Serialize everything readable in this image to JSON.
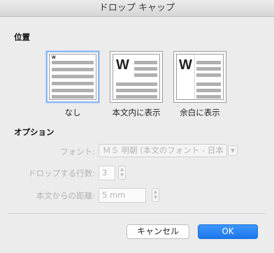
{
  "window": {
    "title": "ドロップ キャップ"
  },
  "position_section": {
    "title": "位置",
    "options": [
      {
        "label": "なし",
        "selected": true,
        "preview_letter": "W"
      },
      {
        "label": "本文内に表示",
        "selected": false,
        "preview_letter": "W"
      },
      {
        "label": "余白に表示",
        "selected": false,
        "preview_letter": "W"
      }
    ]
  },
  "options_section": {
    "title": "オプション",
    "font": {
      "label": "フォント:",
      "value": "ＭＳ 明朝 (本文のフォント - 日本"
    },
    "lines": {
      "label": "ドロップする行数:",
      "value": "3"
    },
    "distance": {
      "label": "本文からの距離:",
      "value": "5 mm"
    }
  },
  "buttons": {
    "cancel": "キャンセル",
    "ok": "OK"
  },
  "colors": {
    "selection_border": "#8db7ee",
    "ok_button": "#2a84f2",
    "disabled_text": "#b4b4b4"
  }
}
